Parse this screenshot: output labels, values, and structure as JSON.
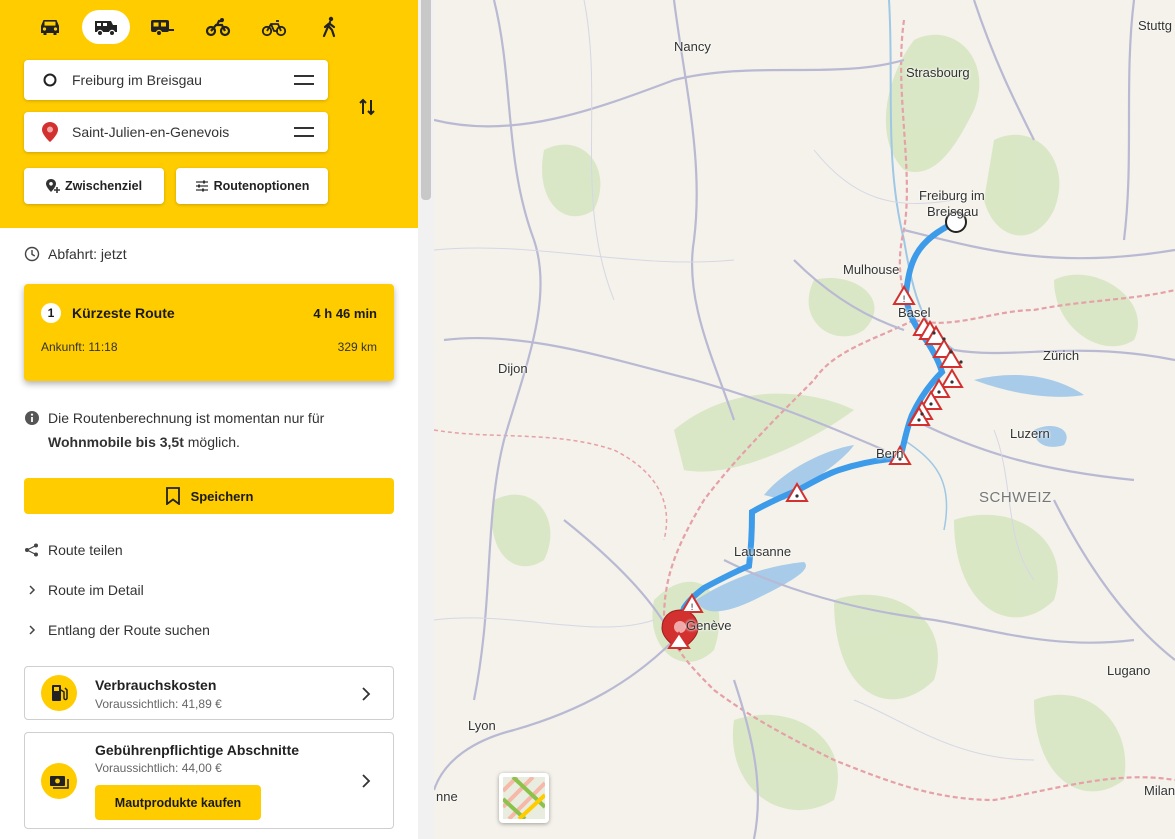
{
  "modes": [
    {
      "name": "car",
      "active": false
    },
    {
      "name": "camper",
      "active": true
    },
    {
      "name": "caravan",
      "active": false
    },
    {
      "name": "motorbike",
      "active": false
    },
    {
      "name": "bicycle",
      "active": false
    },
    {
      "name": "pedestrian",
      "active": false
    }
  ],
  "route": {
    "start": "Freiburg im Breisgau",
    "destination": "Saint-Julien-en-Genevois",
    "waypoint_label": "Zwischenziel",
    "options_label": "Routenoptionen"
  },
  "departure": "Abfahrt: jetzt",
  "route_card": {
    "number": "1",
    "name": "Kürzeste Route",
    "duration": "4 h 46 min",
    "arrival": "Ankunft: 11:18",
    "distance": "329 km"
  },
  "notice": {
    "part1": "Die Routenberechnung ist momentan nur für ",
    "bold": "Wohnmobile bis 3,5t",
    "part2": " möglich."
  },
  "save_label": "Speichern",
  "links": {
    "share": "Route teilen",
    "detail": "Route im Detail",
    "search": "Entlang der Route suchen"
  },
  "fuel": {
    "title": "Verbrauchskosten",
    "subtitle": "Voraussichtlich: 41,89 €"
  },
  "toll": {
    "title": "Gebührenpflichtige Abschnitte",
    "subtitle": "Voraussichtlich: 44,00 €",
    "button": "Mautprodukte kaufen"
  },
  "map": {
    "cities": {
      "nancy": "Nancy",
      "strasbourg": "Strasbourg",
      "stuttgart": "Stuttg",
      "freiburg1": "Freiburg im",
      "freiburg2": "Breisgau",
      "mulhouse": "Mulhouse",
      "basel": "Basel",
      "zurich": "Zürich",
      "dijon": "Dijon",
      "luzern": "Luzern",
      "bern": "Bern",
      "lausanne": "Lausanne",
      "geneve": "Genève",
      "lugano": "Lugano",
      "lyon": "Lyon",
      "anne": "nne",
      "milano": "Milano"
    },
    "country": "SCHWEIZ",
    "route_color": "#3d9be9",
    "accent": "#ffcc00"
  }
}
